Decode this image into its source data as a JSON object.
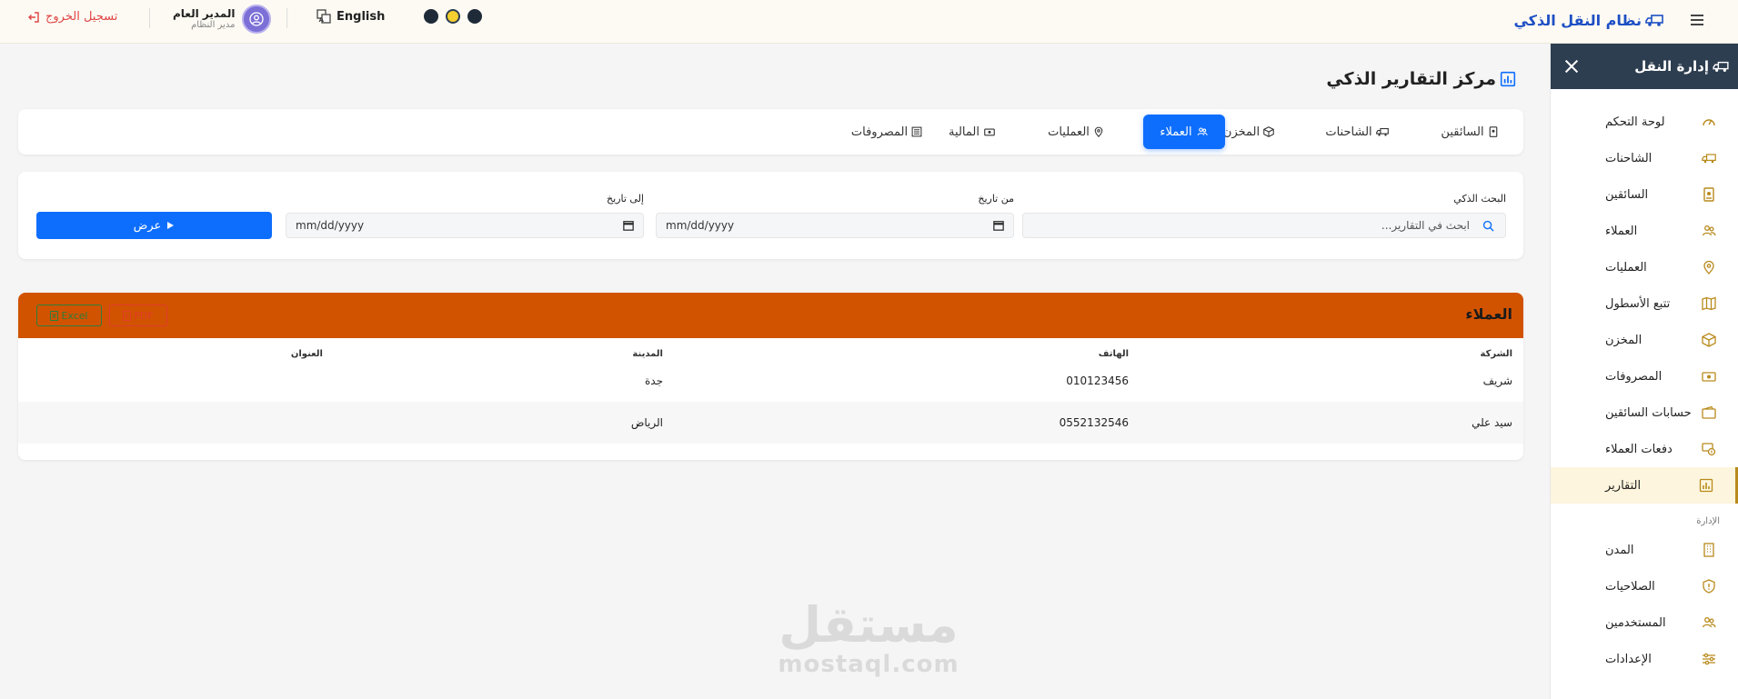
{
  "topbar": {
    "brand": "نظام النقل الذكي",
    "lang_label": "English",
    "user_name": "المدير العام",
    "user_role": "مدير النظام",
    "logout_label": "تسجيل الخروج",
    "theme_colors": [
      "#1e2a38",
      "#f4cf2f",
      "#1e2a38"
    ]
  },
  "sidebar": {
    "title": "إدارة النقل",
    "items": [
      {
        "label": "لوحة التحكم",
        "icon": "gauge-icon"
      },
      {
        "label": "الشاحنات",
        "icon": "truck-icon"
      },
      {
        "label": "السائقين",
        "icon": "id-badge-icon"
      },
      {
        "label": "العملاء",
        "icon": "users-icon"
      },
      {
        "label": "العمليات",
        "icon": "map-pin-icon"
      },
      {
        "label": "تتبع الأسطول",
        "icon": "map-icon"
      },
      {
        "label": "المخزن",
        "icon": "box-icon"
      },
      {
        "label": "المصروفات",
        "icon": "money-icon"
      },
      {
        "label": "حسابات السائقين",
        "icon": "wallet-icon"
      },
      {
        "label": "دفعات العملاء",
        "icon": "payment-icon"
      },
      {
        "label": "التقارير",
        "icon": "chart-icon",
        "active": true
      }
    ],
    "section_label": "الإدارة",
    "admin_items": [
      {
        "label": "المدن",
        "icon": "building-icon"
      },
      {
        "label": "الصلاحيات",
        "icon": "shield-icon"
      },
      {
        "label": "المستخدمين",
        "icon": "users-icon"
      },
      {
        "label": "الإعدادات",
        "icon": "sliders-icon"
      }
    ]
  },
  "page": {
    "title": "مركز التقارير الذكي",
    "tabs": [
      {
        "label": "السائقين",
        "icon": "id-badge-icon"
      },
      {
        "label": "الشاحنات",
        "icon": "truck-icon"
      },
      {
        "label": "المخزن",
        "icon": "box-icon"
      },
      {
        "label": "العملاء",
        "icon": "users-icon",
        "active": true
      },
      {
        "label": "العمليات",
        "icon": "map-pin-icon"
      },
      {
        "label": "المالية",
        "icon": "money-icon"
      },
      {
        "label": "المصروفات",
        "icon": "list-icon"
      }
    ]
  },
  "filters": {
    "search_label": "البحث الذكي",
    "search_placeholder": "ابحث في التقارير...",
    "from_label": "من تاريخ",
    "from_value": "mm/dd/yyyy",
    "to_label": "إلى تاريخ",
    "to_value": "mm/dd/yyyy",
    "show_label": "عرض"
  },
  "report": {
    "title": "العملاء",
    "excel_label": "Excel",
    "pdf_label": "PDF",
    "columns": [
      "الشركة",
      "الهاتف",
      "المدينة",
      "العنوان"
    ],
    "rows": [
      [
        "شريف",
        "010123456",
        "جدة",
        ""
      ],
      [
        "سيد علي",
        "0552132546",
        "الرياض",
        ""
      ]
    ]
  },
  "watermark": {
    "logo_text": "مستقل",
    "url": "mostaql.com"
  },
  "colors": {
    "primary": "#0d6efd",
    "report_header": "#d15300",
    "sidebar_header": "#2d3e50",
    "active_item_bg": "#fdf5dd",
    "logout": "#e04545"
  }
}
